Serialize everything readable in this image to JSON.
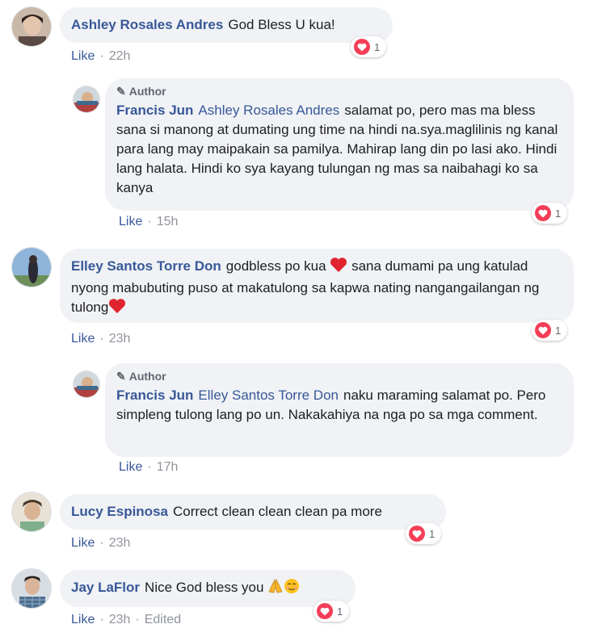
{
  "comments": [
    {
      "author": "Ashley Rosales Andres",
      "text": "God Bless U kua!",
      "like_label": "Like",
      "time": "22h",
      "reactions": "1"
    },
    {
      "author_tag": "Author",
      "author": "Francis Jun",
      "mention": "Ashley Rosales Andres",
      "text": "salamat po, pero mas ma bless sana si manong at dumating ung time na hindi na.sya.maglilinis ng kanal para lang may maipakain sa pamilya. Mahirap lang din po lasi ako. Hindi lang halata. Hindi ko sya kayang tulungan ng mas sa naibahagi ko sa kanya",
      "like_label": "Like",
      "time": "15h",
      "reactions": "1"
    },
    {
      "author": "Elley Santos Torre Don",
      "text_a": "godbless po kua",
      "text_b": "sana dumami pa ung katulad nyong mabubuting puso at makatulong sa kapwa nating nangangailangan ng tulong",
      "like_label": "Like",
      "time": "23h",
      "reactions": "1"
    },
    {
      "author_tag": "Author",
      "author": "Francis Jun",
      "mention": "Elley Santos Torre Don",
      "text": "naku maraming salamat po. Pero simpleng tulong lang po un. Nakakahiya na nga po sa mga comment.",
      "like_label": "Like",
      "time": "17h"
    },
    {
      "author": "Lucy Espinosa",
      "text": "Correct clean clean clean pa more",
      "like_label": "Like",
      "time": "23h",
      "reactions": "1"
    },
    {
      "author": "Jay LaFlor",
      "text": "Nice God bless you",
      "like_label": "Like",
      "time": "23h",
      "edited": "Edited",
      "reactions": "1"
    }
  ],
  "icons": {
    "heart_color": "#f33e58",
    "link_color": "#385898",
    "bubble_color": "#f0f2f5"
  }
}
